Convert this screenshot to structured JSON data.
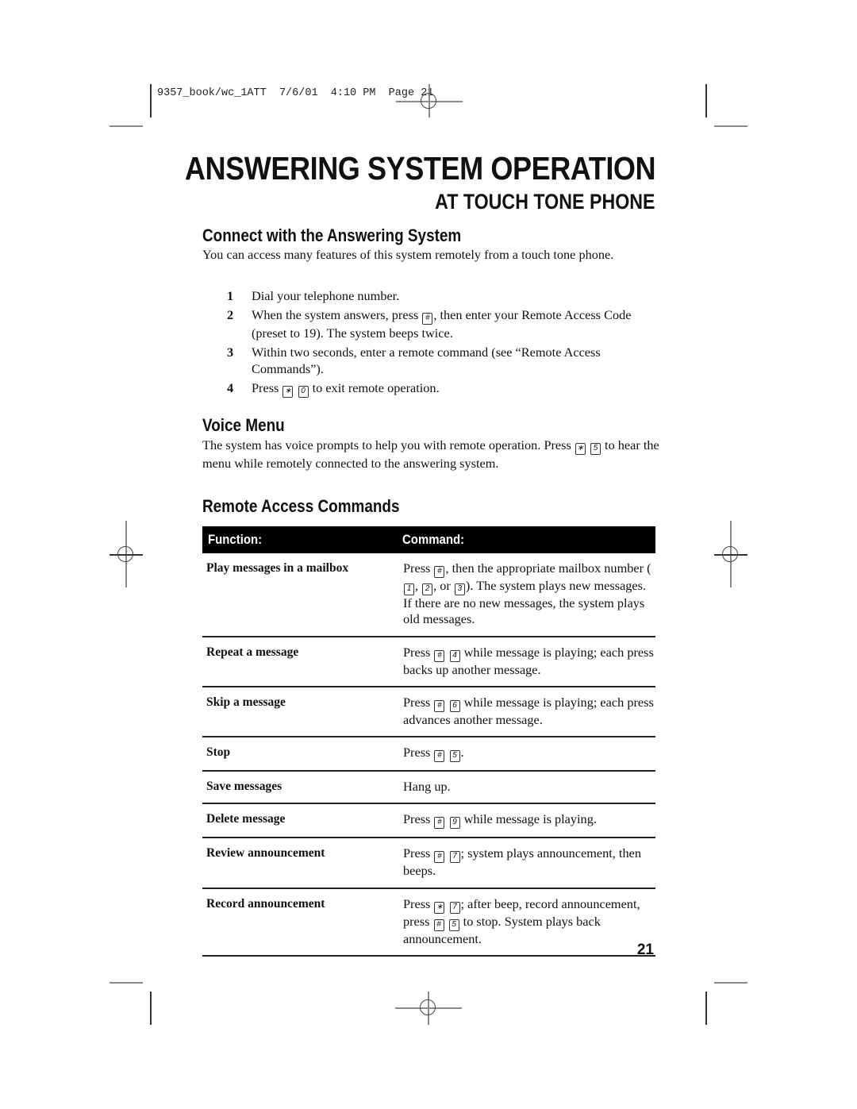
{
  "slug": {
    "file": "9357_book/wc_1ATT",
    "date": "7/6/01",
    "time": "4:10 PM",
    "page_label": "Page",
    "page_number": "21"
  },
  "header": {
    "title": "ANSWERING SYSTEM OPERATION",
    "subtitle": "AT TOUCH TONE PHONE"
  },
  "connect": {
    "heading": "Connect with the Answering System",
    "intro": "You can access many features of this system remotely from a touch tone phone.",
    "steps": [
      {
        "num": "1",
        "parts": [
          {
            "t": "Dial your telephone number."
          }
        ]
      },
      {
        "num": "2",
        "parts": [
          {
            "t": "When the system answers, press "
          },
          {
            "k": "#"
          },
          {
            "t": ", then enter your Remote Access Code (preset to 19). The system beeps twice."
          }
        ]
      },
      {
        "num": "3",
        "parts": [
          {
            "t": "Within two seconds, enter a remote command (see “Remote Access Commands”)."
          }
        ]
      },
      {
        "num": "4",
        "parts": [
          {
            "t": "Press "
          },
          {
            "k": "*"
          },
          {
            "t": " "
          },
          {
            "k": "0"
          },
          {
            "t": " to exit remote operation."
          }
        ]
      }
    ]
  },
  "voice_menu": {
    "heading": "Voice Menu",
    "body": [
      {
        "t": "The system has voice prompts to help you with remote operation.  Press "
      },
      {
        "k": "*"
      },
      {
        "t": " "
      },
      {
        "k": "5"
      },
      {
        "t": " to hear the menu while remotely connected to the answering system."
      }
    ]
  },
  "remote_commands": {
    "heading": "Remote Access Commands",
    "col_function": "Function:",
    "col_command": "Command:",
    "rows": [
      {
        "function": "Play messages in a mailbox",
        "command": [
          {
            "t": "Press "
          },
          {
            "k": "#"
          },
          {
            "t": ", then the appropriate mailbox number ("
          },
          {
            "k": "1"
          },
          {
            "t": ", "
          },
          {
            "k": "2"
          },
          {
            "t": ", or "
          },
          {
            "k": "3"
          },
          {
            "t": "). The system plays new messages.  If there are no new messages, the system plays old messages."
          }
        ]
      },
      {
        "function": "Repeat a message",
        "command": [
          {
            "t": "Press "
          },
          {
            "k": "#"
          },
          {
            "t": " "
          },
          {
            "k": "4"
          },
          {
            "t": " while message is playing; each press backs up another message."
          }
        ]
      },
      {
        "function": "Skip a message",
        "command": [
          {
            "t": "Press "
          },
          {
            "k": "#"
          },
          {
            "t": " "
          },
          {
            "k": "6"
          },
          {
            "t": " while message is playing; each press advances another message."
          }
        ]
      },
      {
        "function": "Stop",
        "command": [
          {
            "t": "Press "
          },
          {
            "k": "#"
          },
          {
            "t": " "
          },
          {
            "k": "5"
          },
          {
            "t": "."
          }
        ]
      },
      {
        "function": "Save messages",
        "command": [
          {
            "t": "Hang up."
          }
        ]
      },
      {
        "function": "Delete message",
        "command": [
          {
            "t": "Press "
          },
          {
            "k": "#"
          },
          {
            "t": " "
          },
          {
            "k": "9"
          },
          {
            "t": " while message is playing."
          }
        ]
      },
      {
        "function": "Review announcement",
        "command": [
          {
            "t": "Press "
          },
          {
            "k": "#"
          },
          {
            "t": " "
          },
          {
            "k": "7"
          },
          {
            "t": "; system plays announcement, then beeps."
          }
        ]
      },
      {
        "function": "Record announcement",
        "command": [
          {
            "t": "Press "
          },
          {
            "k": "*"
          },
          {
            "t": " "
          },
          {
            "k": "7"
          },
          {
            "t": "; after beep, record announcement, press "
          },
          {
            "k": "#"
          },
          {
            "t": " "
          },
          {
            "k": "5"
          },
          {
            "t": " to stop. System plays back announcement."
          }
        ]
      }
    ]
  },
  "footer": {
    "page_number": "21"
  }
}
